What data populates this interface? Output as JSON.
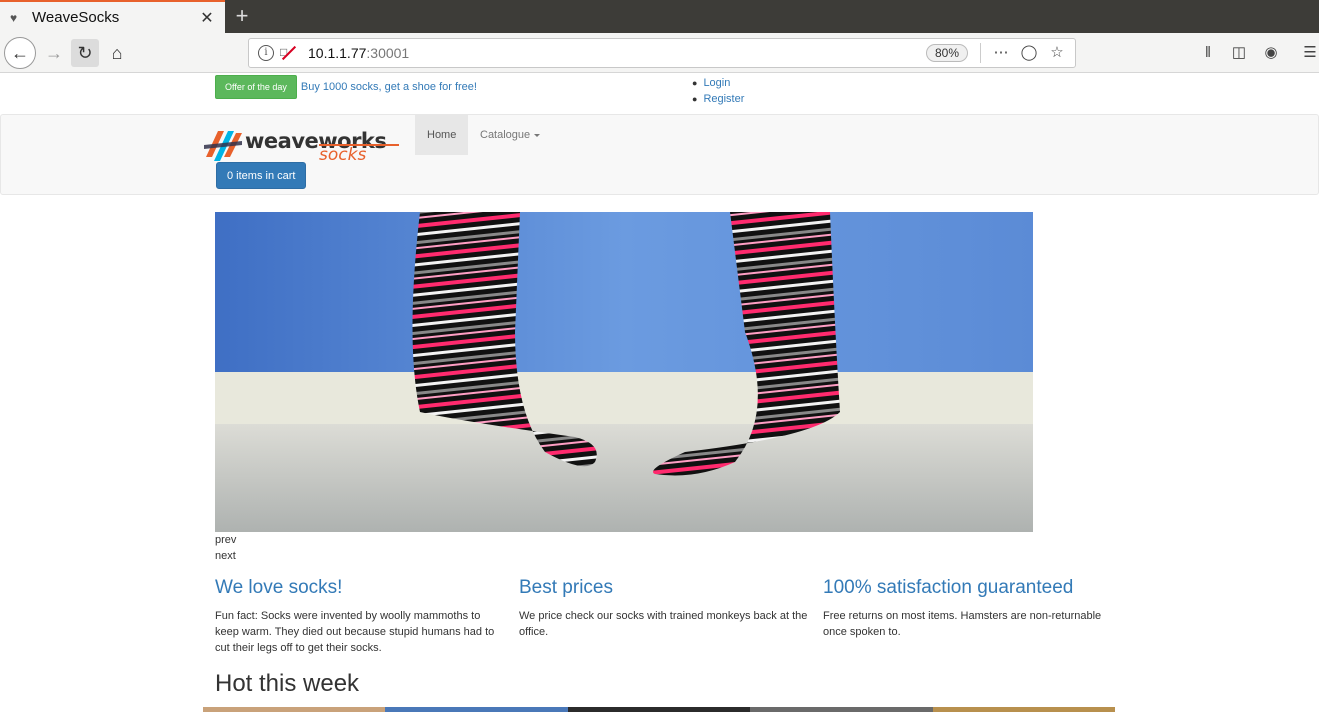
{
  "browser": {
    "tab_title": "WeaveSocks",
    "url_host": "10.1.1.77",
    "url_port": ":30001",
    "zoom": "80%"
  },
  "topbar": {
    "offer_label": "Offer of the day",
    "offer_text": "Buy 1000 socks, get a shoe for free!",
    "account_links": [
      "Login",
      "Register"
    ]
  },
  "nav": {
    "logo_main": "weaveworks",
    "logo_sub": "socks",
    "home": "Home",
    "catalogue": "Catalogue",
    "cart": "0 items in cart"
  },
  "carousel": {
    "prev": "prev",
    "next": "next"
  },
  "features": [
    {
      "title": "We love socks!",
      "text": "Fun fact: Socks were invented by woolly mammoths to keep warm. They died out because stupid humans had to cut their legs off to get their socks."
    },
    {
      "title": "Best prices",
      "text": "We price check our socks with trained monkeys back at the office."
    },
    {
      "title": "100% satisfaction guaranteed",
      "text": "Free returns on most items. Hamsters are non-returnable once spoken to."
    }
  ],
  "hot": {
    "title": "Hot this week"
  },
  "colors": {
    "link": "#337ab7",
    "offer_green": "#5cb85c",
    "brand_orange": "#e8612c"
  }
}
